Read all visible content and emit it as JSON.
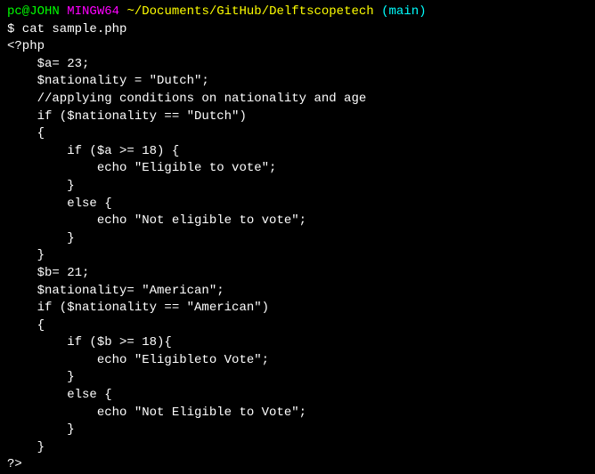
{
  "prompt": {
    "user": "pc@JOHN",
    "host": "MINGW64",
    "path": "~/Documents/GitHub/Delftscopetech",
    "branch": "(main)"
  },
  "command": "$ cat sample.php",
  "code": {
    "l01": "<?php",
    "l02": "    $a= 23;",
    "l03": "    $nationality = \"Dutch\";",
    "l04": "    //applying conditions on nationality and age",
    "l05": "    if ($nationality == \"Dutch\")",
    "l06": "    {",
    "l07": "        if ($a >= 18) {",
    "l08": "            echo \"Eligible to vote\";",
    "l09": "        }",
    "l10": "        else {",
    "l11": "            echo \"Not eligible to vote\";",
    "l12": "        }",
    "l13": "    }",
    "l14": "    $b= 21;",
    "l15": "    $nationality= \"American\";",
    "l16": "    if ($nationality == \"American\")",
    "l17": "    {",
    "l18": "        if ($b >= 18){",
    "l19": "            echo \"Eligibleto Vote\";",
    "l20": "        }",
    "l21": "        else {",
    "l22": "            echo \"Not Eligible to Vote\";",
    "l23": "        }",
    "l24": "    }",
    "l25": "?>"
  }
}
